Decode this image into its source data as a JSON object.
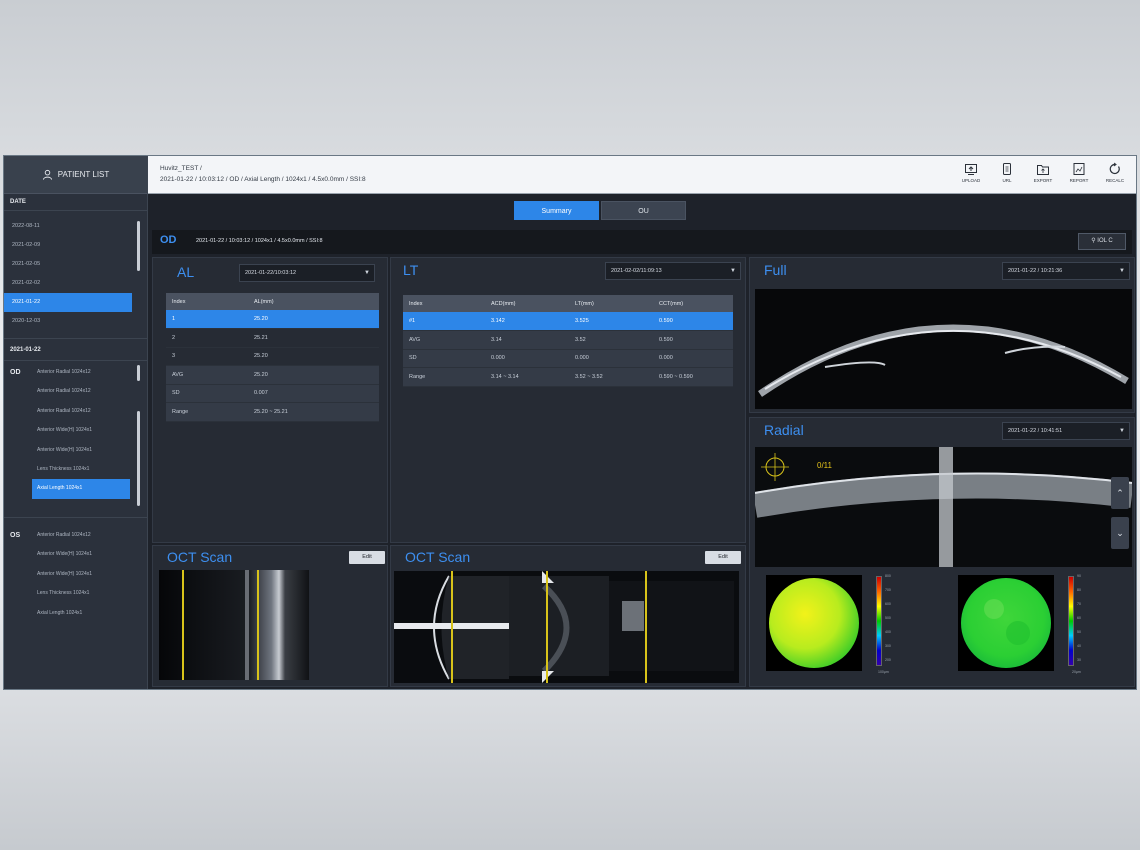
{
  "sidebar": {
    "patient_list": "PATIENT LIST",
    "date_header": "DATE",
    "dates": [
      "2022-08-11",
      "2021-02-09",
      "2021-02-05",
      "2021-02-02",
      "2021-01-22",
      "2020-12-03"
    ],
    "selected_date": "2021-01-22",
    "od_label": "OD",
    "od_scans": [
      "Anterior Radial 1024x12",
      "Anterior Radial 1024x12",
      "Anterior Radial 1024x12",
      "Anterior Wide(H) 1024x1",
      "Anterior Wide(H) 1024x1",
      "Lens Thickness 1024x1",
      "Axial Length 1024x1"
    ],
    "os_label": "OS",
    "os_scans": [
      "Anterior Radial 1024x12",
      "Anterior Wide(H) 1024x1",
      "Anterior Wide(H) 1024x1",
      "Lens Thickness 1024x1",
      "Axial Length 1024x1"
    ]
  },
  "header": {
    "line1": "Huvitz_TEST /",
    "line2": "2021-01-22 / 10:03:12 / OD / Axial Length / 1024x1 / 4.5x0.0mm / SSI:8",
    "tools": [
      "UPLOAD",
      "URL",
      "EXPORT",
      "REPORT",
      "RECALC"
    ]
  },
  "tabs": [
    "Summary",
    "OU"
  ],
  "infobar": {
    "eye": "OD",
    "text": "2021-01-22 / 10:03:12 / 1024x1 / 4.5x0.0mm / SSI:8",
    "iol_button": "IOL C"
  },
  "al": {
    "title": "AL",
    "date": "2021-01-22/10:03:12",
    "headers": [
      "Index",
      "AL(mm)"
    ],
    "rows": [
      [
        "1",
        "25.20"
      ],
      [
        "2",
        "25.21"
      ],
      [
        "3",
        "25.20"
      ]
    ],
    "stats": [
      [
        "AVG",
        "25.20"
      ],
      [
        "SD",
        "0.007"
      ],
      [
        "Range",
        "25.20 ~ 25.21"
      ]
    ]
  },
  "lt": {
    "title": "LT",
    "date": "2021-02-02/11:09:13",
    "headers": [
      "Index",
      "ACD(mm)",
      "LT(mm)",
      "CCT(mm)"
    ],
    "rows": [
      [
        "#1",
        "3.142",
        "3.525",
        "0.590"
      ]
    ],
    "stats": [
      [
        "AVG",
        "3.14",
        "3.52",
        "0.590"
      ],
      [
        "SD",
        "0.000",
        "0.000",
        "0.000"
      ],
      [
        "Range",
        "3.14 ~ 3.14",
        "3.52 ~ 3.52",
        "0.590 ~ 0.590"
      ]
    ]
  },
  "oct1": {
    "title": "OCT Scan",
    "edit": "Edit"
  },
  "oct2": {
    "title": "OCT Scan",
    "edit": "Edit"
  },
  "full": {
    "title": "Full",
    "date": "2021-01-22 / 10:21:36"
  },
  "radial": {
    "title": "Radial",
    "date": "2021-01-22 / 10:41:51",
    "counter": "0/11",
    "up": "⌃",
    "down": "⌄"
  },
  "maps": {
    "left_labels": [
      "800",
      "700",
      "600",
      "500",
      "400",
      "300",
      "200"
    ],
    "left_unit": "100µm",
    "right_labels": [
      "90",
      "80",
      "70",
      "60",
      "50",
      "40",
      "30"
    ],
    "right_unit": "20µm"
  }
}
